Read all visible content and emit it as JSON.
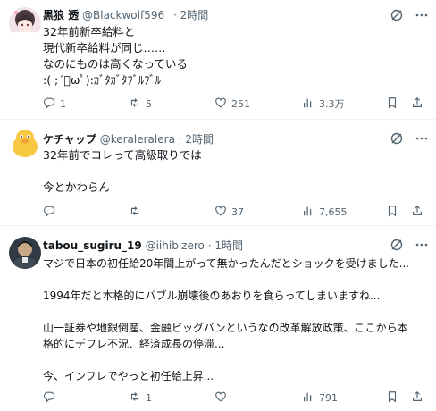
{
  "tweets": [
    {
      "name": "黒狼 透",
      "handle": "@Blackwolf596_",
      "dot": "·",
      "time": "2時間",
      "lines": [
        "32年前新卒給料と",
        "現代新卒給料が同じ……",
        "なのにものは高くなっている",
        ":( ;´ﾟωﾟ):ｶﾞﾀｶﾞﾀﾌﾞﾙﾌﾞﾙ"
      ],
      "reply_count": "1",
      "repost_count": "5",
      "like_count": "251",
      "view_count": "3.3万"
    },
    {
      "name": "ケチャップ",
      "handle": "@keraleralera",
      "dot": "·",
      "time": "2時間",
      "lines": [
        "32年前でコレって高級取りでは",
        "",
        "今とかわらん"
      ],
      "reply_count": "",
      "repost_count": "",
      "like_count": "37",
      "view_count": "7,655"
    },
    {
      "name": "tabou_sugiru_19",
      "handle": "@iihibizero",
      "dot": "·",
      "time": "1時間",
      "lines": [
        "マジで日本の初任給20年間上がって無かったんだとショックを受けました...",
        "",
        "1994年だと本格的にバブル崩壊後のあおりを食らってしまいますね...",
        "",
        "山一証券や地銀倒産、金融ビッグバンというなの改革解放政策、ここから本",
        "格的にデフレ不況、経済成長の停滞...",
        "",
        "今、インフレでやっと初任給上昇..."
      ],
      "reply_count": "",
      "repost_count": "1",
      "like_count": "",
      "view_count": "791"
    }
  ],
  "icons": {
    "grok": "grok-icon",
    "more": "more-icon",
    "reply": "reply-icon",
    "repost": "repost-icon",
    "like": "like-icon",
    "views": "views-icon",
    "bookmark": "bookmark-icon",
    "share": "share-icon"
  },
  "colors": {
    "text": "#0f1419",
    "secondary": "#536471",
    "divider": "#eff3f4"
  }
}
